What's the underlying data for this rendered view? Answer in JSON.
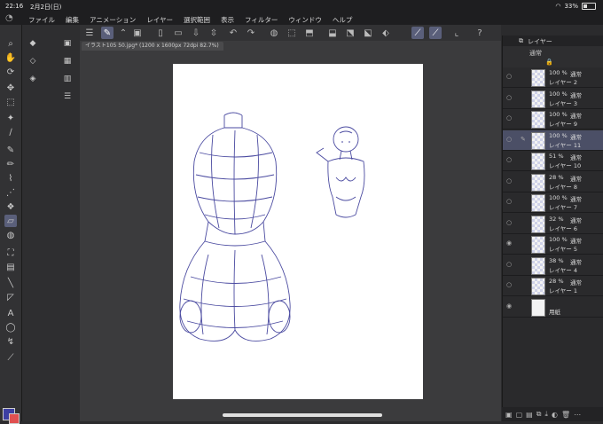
{
  "status": {
    "time": "22:16",
    "date": "2月2日(日)",
    "wifi_icon": "wifi-icon",
    "battery": "33%"
  },
  "menu": [
    "ファイル",
    "編集",
    "アニメーション",
    "レイヤー",
    "選択範囲",
    "表示",
    "フィルター",
    "ウィンドウ",
    "ヘルプ"
  ],
  "canvas": {
    "tab_title": "イラスト105 50.jpg* (1200 x 1600px 72dpi 82.7%)"
  },
  "layers_panel": {
    "title": "レイヤー",
    "blend_mode": "通常",
    "layers": [
      {
        "opacity": "100 %",
        "mode": "通常",
        "name": "レイヤー 2",
        "visible": false,
        "selected": false
      },
      {
        "opacity": "100 %",
        "mode": "通常",
        "name": "レイヤー 3",
        "visible": false,
        "selected": false
      },
      {
        "opacity": "100 %",
        "mode": "通常",
        "name": "レイヤー 9",
        "visible": false,
        "selected": false
      },
      {
        "opacity": "100 %",
        "mode": "通常",
        "name": "レイヤー 11",
        "visible": false,
        "selected": true
      },
      {
        "opacity": "51 %",
        "mode": "通常",
        "name": "レイヤー 10",
        "visible": false,
        "selected": false
      },
      {
        "opacity": "28 %",
        "mode": "通常",
        "name": "レイヤー 8",
        "visible": false,
        "selected": false
      },
      {
        "opacity": "100 %",
        "mode": "通常",
        "name": "レイヤー 7",
        "visible": false,
        "selected": false
      },
      {
        "opacity": "32 %",
        "mode": "通常",
        "name": "レイヤー 6",
        "visible": false,
        "selected": false
      },
      {
        "opacity": "100 %",
        "mode": "通常",
        "name": "レイヤー 5",
        "visible": true,
        "selected": false
      },
      {
        "opacity": "38 %",
        "mode": "通常",
        "name": "レイヤー 4",
        "visible": false,
        "selected": false
      },
      {
        "opacity": "28 %",
        "mode": "通常",
        "name": "レイヤー 1",
        "visible": false,
        "selected": false
      },
      {
        "opacity": "",
        "mode": "",
        "name": "用紙",
        "visible": true,
        "selected": false
      }
    ]
  },
  "colors": {
    "main": "#3c3fa3",
    "sub": "#e05050",
    "selection": "#4b4f66",
    "stroke": "#4a4aa0"
  }
}
